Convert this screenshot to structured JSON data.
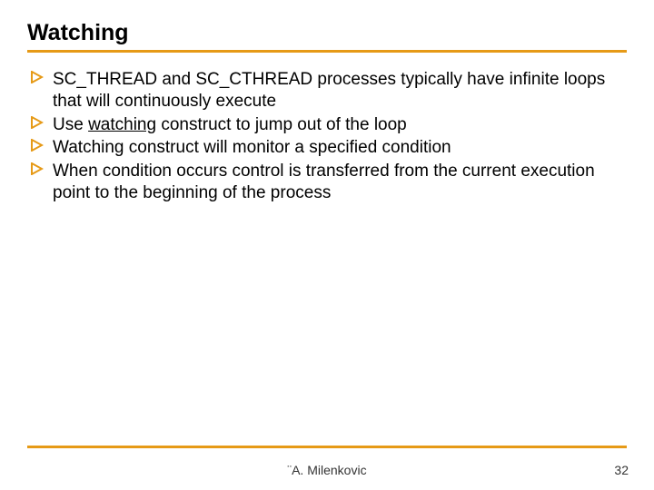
{
  "title": "Watching",
  "bullets": [
    {
      "segments": [
        {
          "text": "SC_THREAD and SC_CTHREAD processes typically have infinite loops that will continuously execute"
        }
      ]
    },
    {
      "segments": [
        {
          "text": "Use "
        },
        {
          "text": "watching",
          "underline": true
        },
        {
          "text": " construct to jump out of the loop"
        }
      ]
    },
    {
      "segments": [
        {
          "text": "Watching construct will monitor a specified condition"
        }
      ]
    },
    {
      "segments": [
        {
          "text": "When condition occurs control is transferred from the current execution point to the beginning of the process"
        }
      ]
    }
  ],
  "footer": {
    "copyright_symbol": "¨",
    "author": "A. Milenkovic"
  },
  "page_number": "32",
  "colors": {
    "accent": "#e69a17"
  }
}
